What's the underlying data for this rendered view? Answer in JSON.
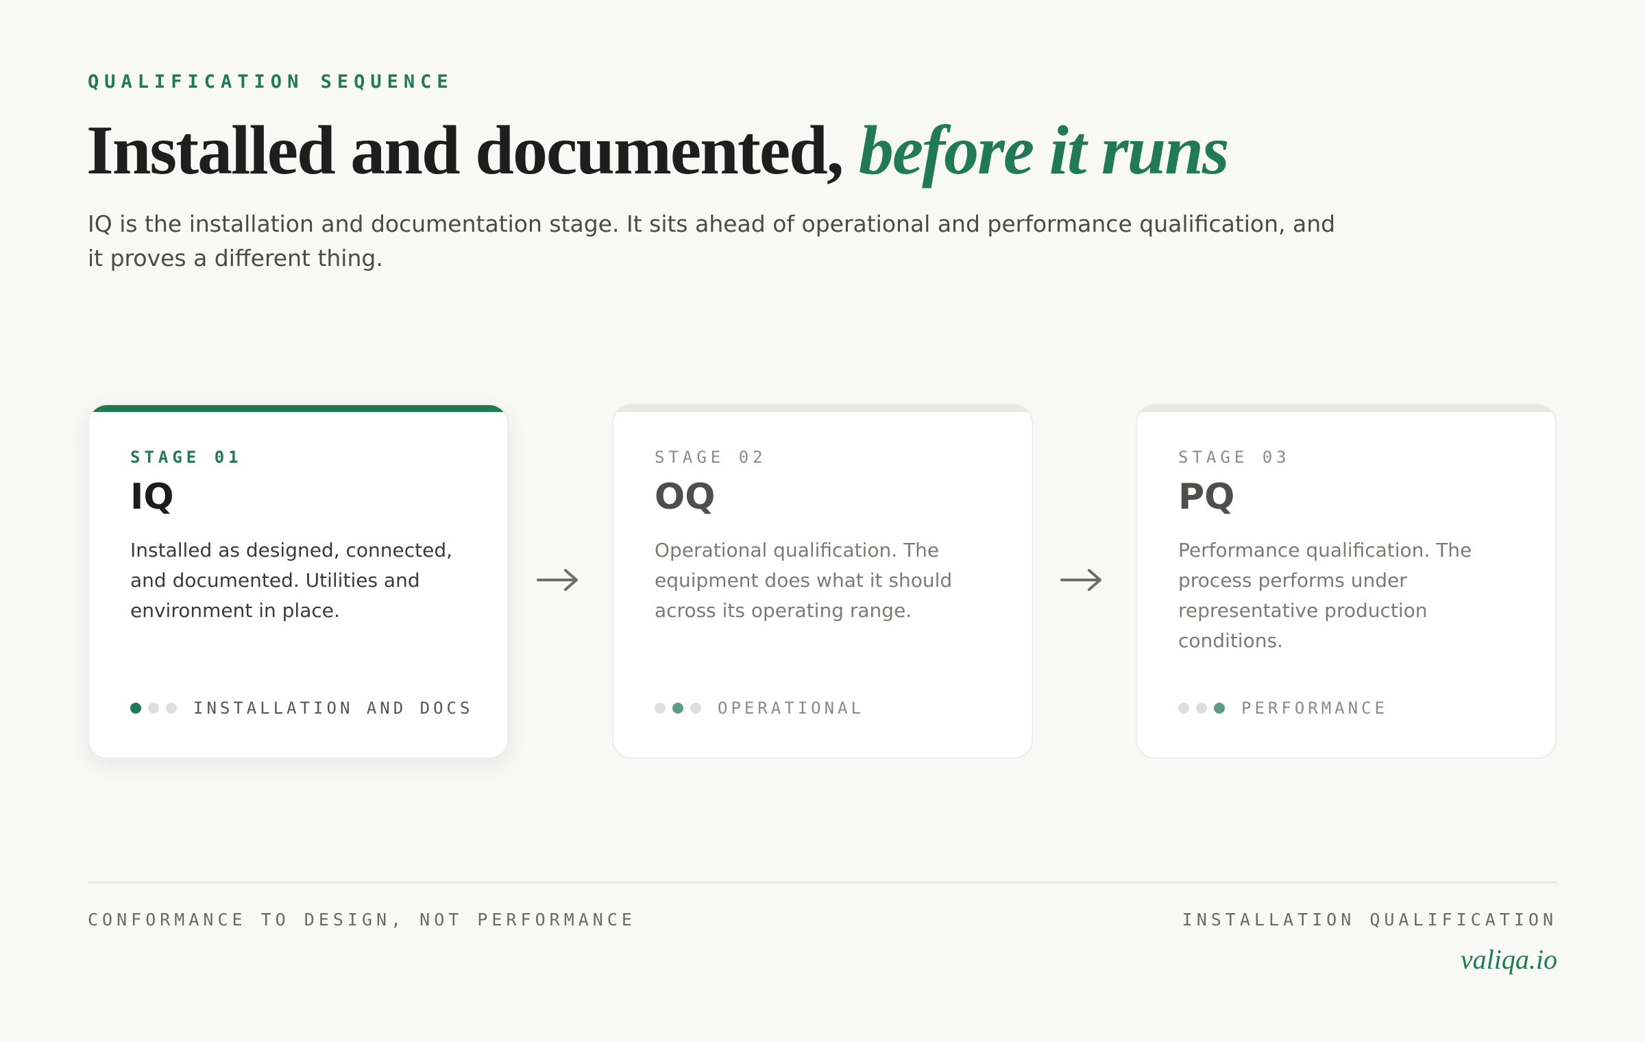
{
  "header": {
    "eyebrow": "QUALIFICATION SEQUENCE",
    "title_main": "Installed and documented, ",
    "title_accent": "before it runs",
    "lede": "IQ is the installation and documentation stage. It sits ahead of operational and performance qualification, and it proves a different thing."
  },
  "colors": {
    "accent": "#1f7a55",
    "muted_text": "#7a7a77",
    "background": "#f8f8f6"
  },
  "stages": [
    {
      "label": "STAGE 01",
      "code": "IQ",
      "description": "Installed as designed, connected, and documented. Utilities and environment in place.",
      "step_label": "INSTALLATION AND DOCS",
      "active": true,
      "step_index": 1,
      "step_total": 3
    },
    {
      "label": "STAGE 02",
      "code": "OQ",
      "description": "Operational qualification. The equipment does what it should across its operating range.",
      "step_label": "OPERATIONAL",
      "active": false,
      "step_index": 2,
      "step_total": 3
    },
    {
      "label": "STAGE 03",
      "code": "PQ",
      "description": "Performance qualification. The process performs under representative production conditions.",
      "step_label": "PERFORMANCE",
      "active": false,
      "step_index": 3,
      "step_total": 3
    }
  ],
  "connector_icon": "arrow-right-icon",
  "footer": {
    "left": "CONFORMANCE TO DESIGN, NOT PERFORMANCE",
    "right": "INSTALLATION QUALIFICATION",
    "brand": "valiqa.io"
  }
}
